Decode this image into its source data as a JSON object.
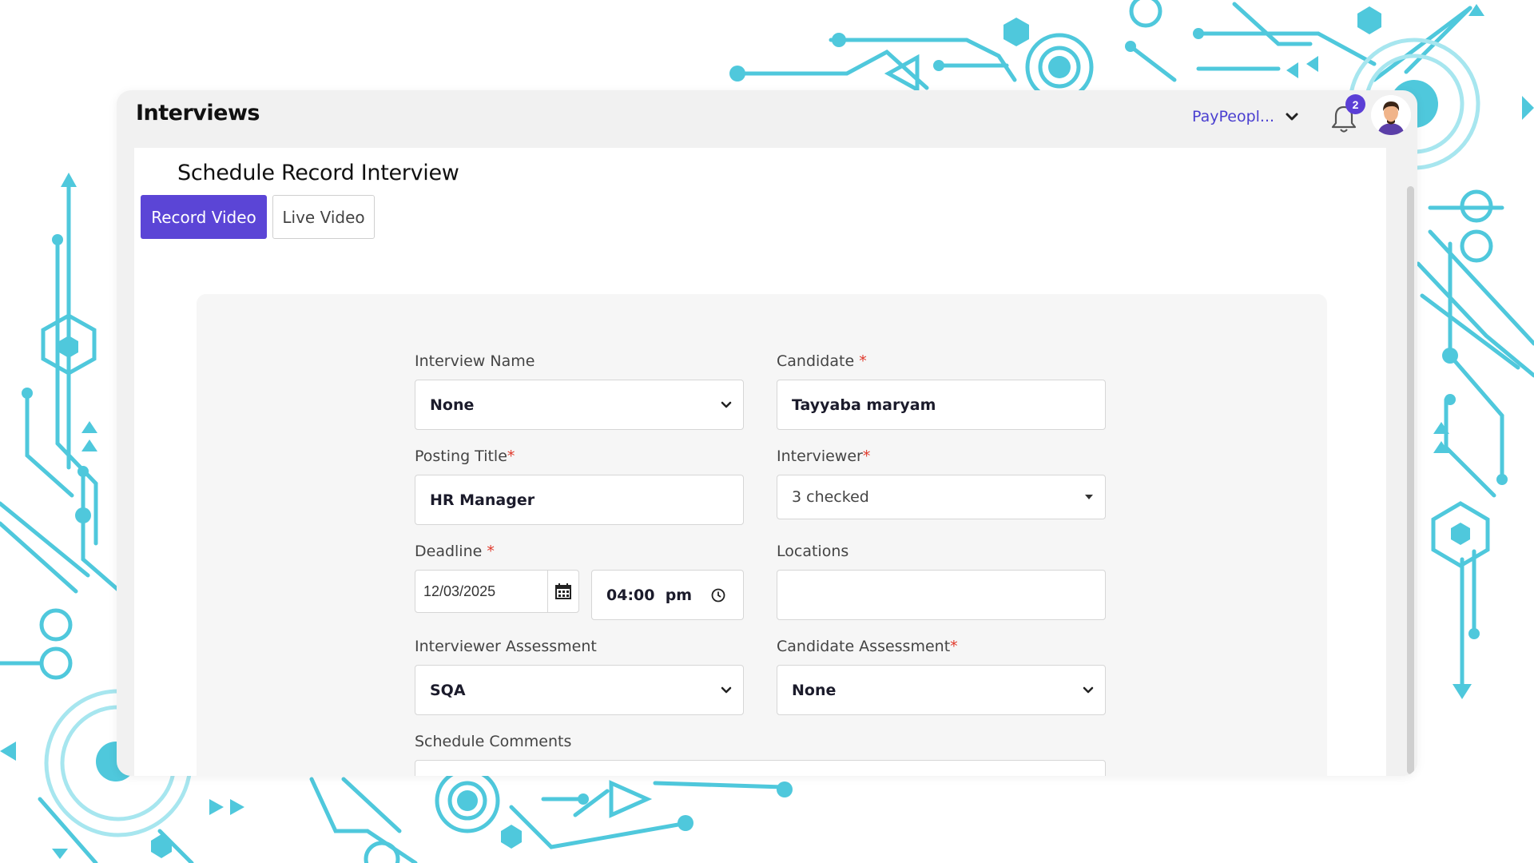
{
  "header": {
    "app_title": "Interviews",
    "company_selector": "PayPeopl...",
    "notification_count": "2"
  },
  "page": {
    "title": "Schedule Record Interview",
    "tabs": [
      {
        "label": "Record Video",
        "active": true
      },
      {
        "label": "Live Video",
        "active": false
      }
    ]
  },
  "form": {
    "interview_name": {
      "label": "Interview Name",
      "value": "None"
    },
    "candidate": {
      "label": "Candidate",
      "required_mark": "*",
      "value": "Tayyaba maryam"
    },
    "posting_title": {
      "label": "Posting Title",
      "required_mark": "*",
      "value": "HR Manager"
    },
    "interviewer": {
      "label": "Interviewer",
      "required_mark": "*",
      "value": "3 checked"
    },
    "deadline": {
      "label": "Deadline",
      "required_mark": "*",
      "date": "12/03/2025",
      "time": "04:00  pm"
    },
    "locations": {
      "label": "Locations",
      "value": ""
    },
    "interviewer_assessment": {
      "label": "Interviewer Assessment",
      "value": "SQA"
    },
    "candidate_assessment": {
      "label": "Candidate Assessment",
      "required_mark": "*",
      "value": "None"
    },
    "schedule_comments": {
      "label": "Schedule Comments",
      "value": ""
    }
  },
  "colors": {
    "primary": "#5b45d6",
    "company_link": "#4a3fd0",
    "required": "#e0392b",
    "decor_light": "#4fd0e3",
    "decor_dark": "#2a9fc9"
  }
}
